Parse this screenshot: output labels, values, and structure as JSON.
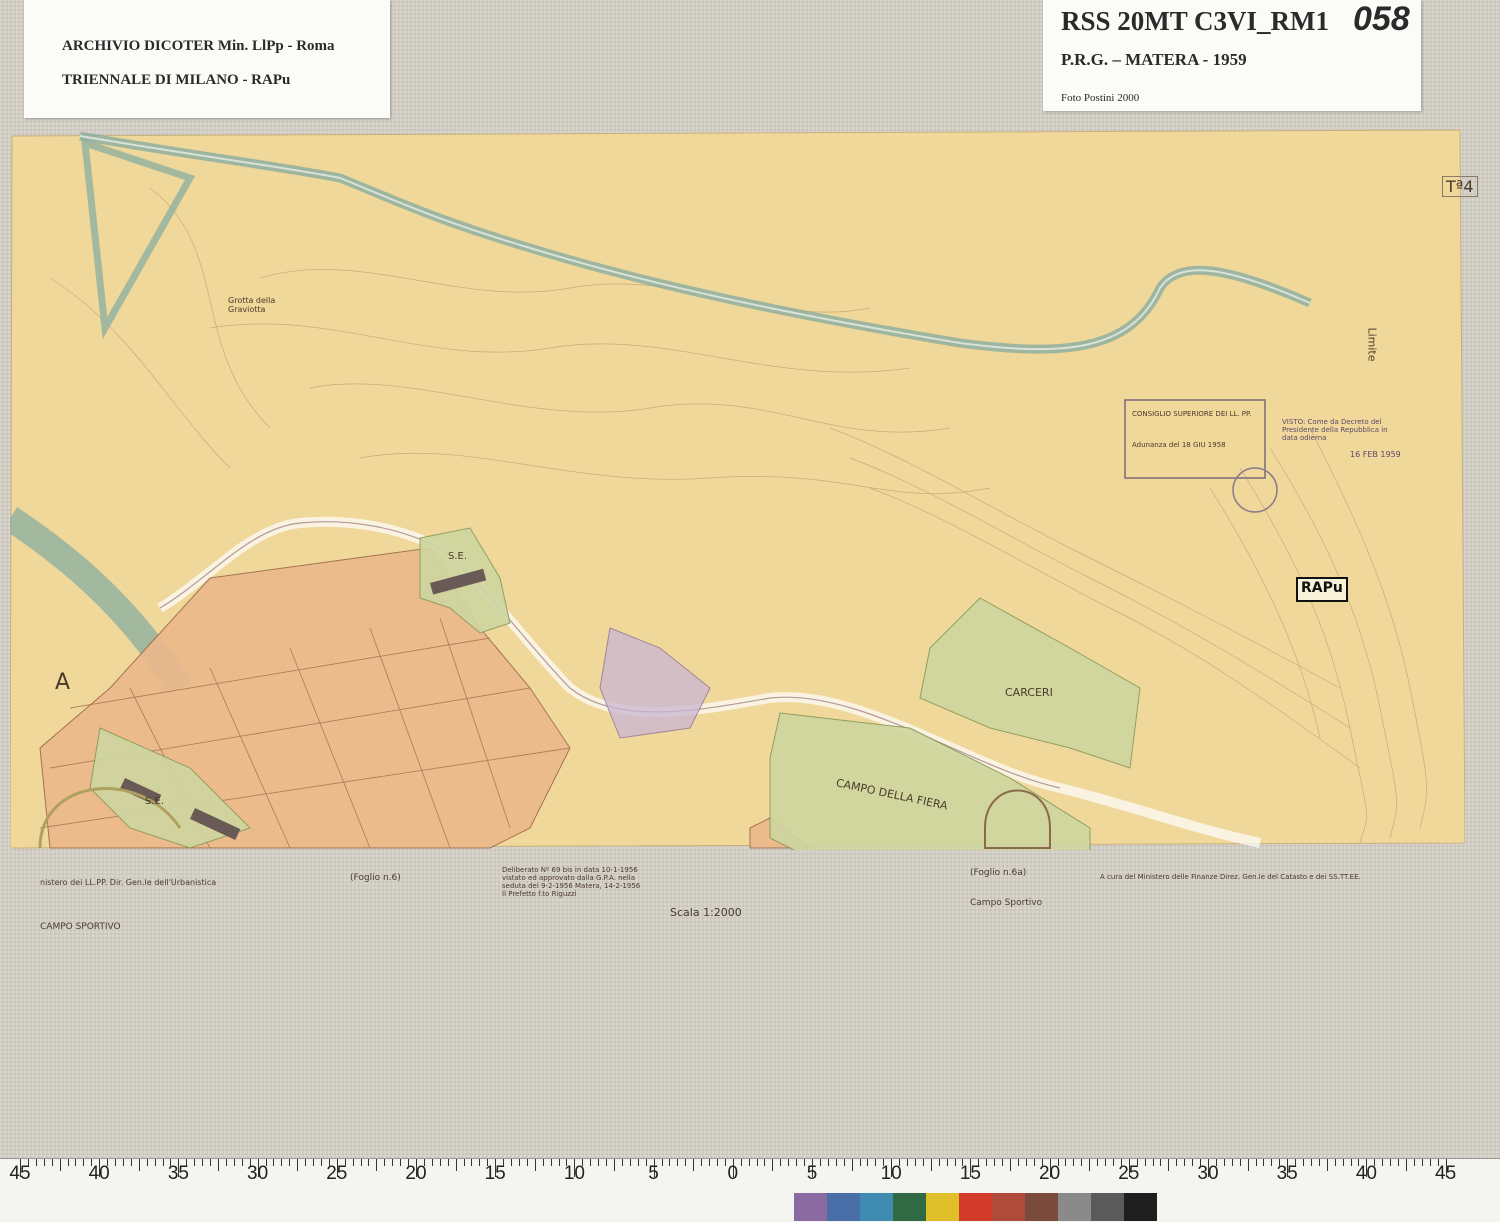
{
  "archive_card": {
    "line1": "ARCHIVIO DICOTER Min. LlPp - Roma",
    "line2": "TRIENNALE DI MILANO - RAPu"
  },
  "record_card": {
    "code": "RSS 20MT C3VI_RM1",
    "number": "058",
    "subtitle": "P.R.G. – MATERA - 1959",
    "photo_credit": "Foto Postini 2000"
  },
  "map": {
    "sheet_number": "Tª4",
    "letter_label": "A",
    "rapu_label": "RAPu",
    "area_labels": {
      "carceri": "CARCERI",
      "campo_fiera": "CAMPO DELLA FIERA",
      "se1": "S.E.",
      "se2": "S.E.",
      "campo_sportivo_bottom": "CAMPO SPORTIVO",
      "campo_sportivo": "Campo Sportivo",
      "limite": "Limite",
      "grotta": "Grotta della Graviotta"
    },
    "stamps": {
      "consiglio": "CONSIGLIO SUPERIORE DEI LL. PP.",
      "adunanza": "Adunanza del 18 GIU 1958",
      "visto": "VISTO: Come da Decreto del Presidente della Repubblica in data odierna",
      "visto_date": "16 FEB 1959"
    },
    "footer": {
      "left": "nistero dei LL.PP. Dir. Gen.le dell'Urbanistica",
      "foglio_left": "(Foglio n.6)",
      "foglio_right": "(Foglio n.6a)",
      "right": "A cura del Ministero delle Finanze Direz. Gen.le del Catasto e dei SS.TT.EE.",
      "scale": "Scala 1:2000",
      "deliberation": "Deliberato Nº 69 bis in data 10-1-1956 vistato ed approvato dalla G.P.A. nella seduta del 9-2-1956 Matera, 14-2-1956 Il Prefetto f.to Riguzzi"
    },
    "colors": {
      "paper": "#f0d79a",
      "residential": "#ecb98a",
      "green": "#cfd6a0",
      "canal": "#8fb0a0",
      "purple": "#c9b6d2"
    }
  },
  "ruler": {
    "labels": [
      "45",
      "40",
      "35",
      "30",
      "25",
      "20",
      "15",
      "10",
      "5",
      "0",
      "5",
      "10",
      "15",
      "20",
      "25",
      "30",
      "35",
      "40",
      "45"
    ],
    "swatches": [
      "#8a6aa0",
      "#4a6fa8",
      "#3f8ab0",
      "#2f6a45",
      "#e0c02a",
      "#d23a2a",
      "#b04a3a",
      "#7a4a3a",
      "#8a8a8a",
      "#5a5a5a",
      "#1e1e1e"
    ]
  }
}
